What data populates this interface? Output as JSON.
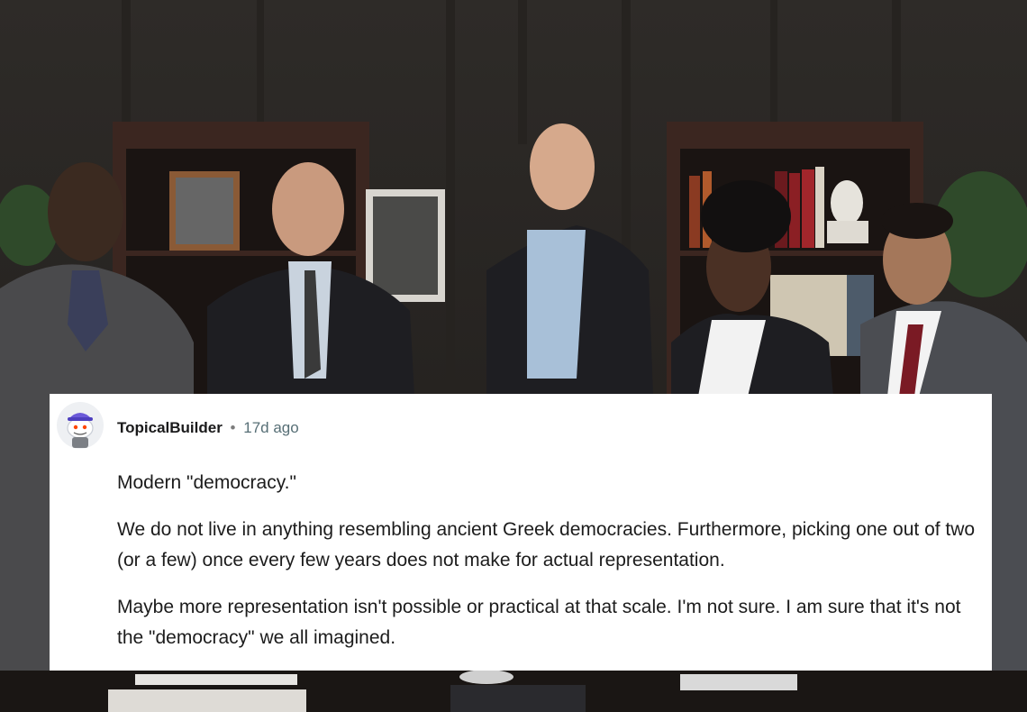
{
  "comment": {
    "username": "TopicalBuilder",
    "separator": "•",
    "time_ago": "17d ago",
    "paragraphs": [
      "Modern \"democracy.\"",
      "We do not live in anything resembling ancient Greek democracies. Furthermore, picking one out of two (or a few) once every few years does not make for actual representation.",
      "Maybe more representation isn't possible or practical at that scale. I'm not sure. I am sure that it's not the \"democracy\" we all imagined."
    ]
  },
  "colors": {
    "card_bg": "#ffffff",
    "text": "#1c1c1c",
    "meta": "#576f76"
  }
}
